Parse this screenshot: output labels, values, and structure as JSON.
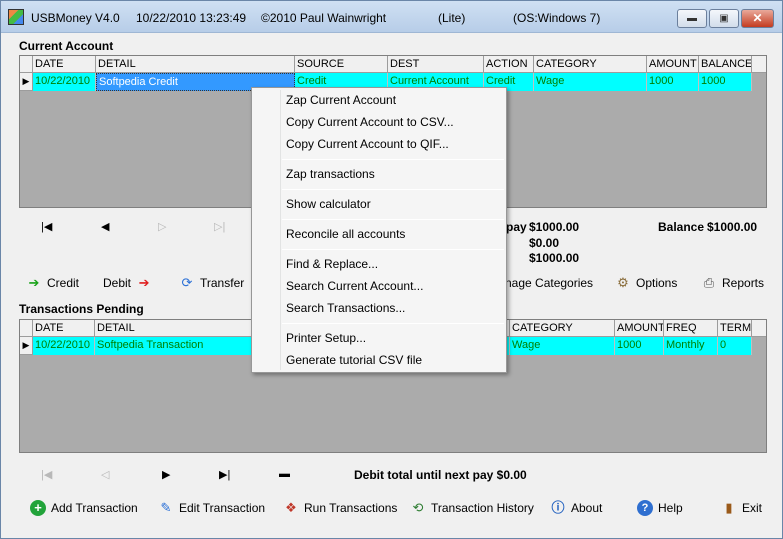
{
  "window": {
    "app": "USBMoney V4.0",
    "datetime": "10/22/2010 13:23:49",
    "copyright": "©2010 Paul Wainwright",
    "edition": "(Lite)",
    "os": "(OS:Windows 7)",
    "minimize_glyph": "▬",
    "maximize_glyph": "▣",
    "close_glyph": "✕"
  },
  "current_account": {
    "label": "Current Account",
    "columns": [
      "DATE",
      "DETAIL",
      "SOURCE",
      "DEST",
      "ACTION",
      "CATEGORY",
      "AMOUNT",
      "BALANCE"
    ],
    "row": [
      "10/22/2010",
      "Softpedia Credit",
      "Credit",
      "Current Account",
      "Credit",
      "Wage",
      "1000",
      "1000"
    ],
    "row_indicator": "▶"
  },
  "nav_top": {
    "first": "|◀",
    "prev": "◀",
    "next": "▷",
    "last": "▷|"
  },
  "summary": {
    "pay_label": "pay",
    "pay_value": "$1000.00",
    "line2": "$0.00",
    "line3": "$1000.00",
    "balance_label": "Balance",
    "balance_value": "$1000.00"
  },
  "toolbar": {
    "credit": "Credit",
    "debit": "Debit",
    "transfer": "Transfer",
    "manage_categories": "nage Categories",
    "options": "Options",
    "reports": "Reports"
  },
  "pending": {
    "label": "Transactions Pending",
    "columns": [
      "DATE",
      "DETAIL",
      "CATEGORY",
      "AMOUNT",
      "FREQ",
      "TERM"
    ],
    "row": [
      "10/22/2010",
      "Softpedia Transaction",
      "Wage",
      "1000",
      "Monthly",
      "0"
    ],
    "row_indicator": "▶"
  },
  "nav_bottom": {
    "first": "|◀",
    "prev": "◁",
    "next": "▶",
    "last": "▶|",
    "minus": "▬"
  },
  "debit_total": "Debit total until next pay $0.00",
  "bottom_bar": {
    "add": "Add Transaction",
    "edit": "Edit Transaction",
    "run": "Run Transactions",
    "history": "Transaction History",
    "about": "About",
    "help": "Help",
    "exit": "Exit"
  },
  "context_menu": {
    "items": [
      "Zap Current Account",
      "Copy Current Account to CSV...",
      "Copy Current Account to QIF...",
      "Zap transactions",
      "Show calculator",
      "Reconcile all accounts",
      "Find & Replace...",
      "Search Current Account...",
      "Search Transactions...",
      "Printer Setup...",
      "Generate tutorial CSV file"
    ]
  },
  "icons": {
    "credit": "green-arrow-icon",
    "debit": "red-arrow-icon",
    "transfer": "refresh-icon",
    "options": "gears-icon",
    "reports": "printer-icon",
    "add": "plus-circle-icon",
    "edit": "pencil-icon",
    "run": "run-icon",
    "history": "history-icon",
    "about": "info-icon",
    "help": "help-icon",
    "exit": "exit-door-icon"
  }
}
